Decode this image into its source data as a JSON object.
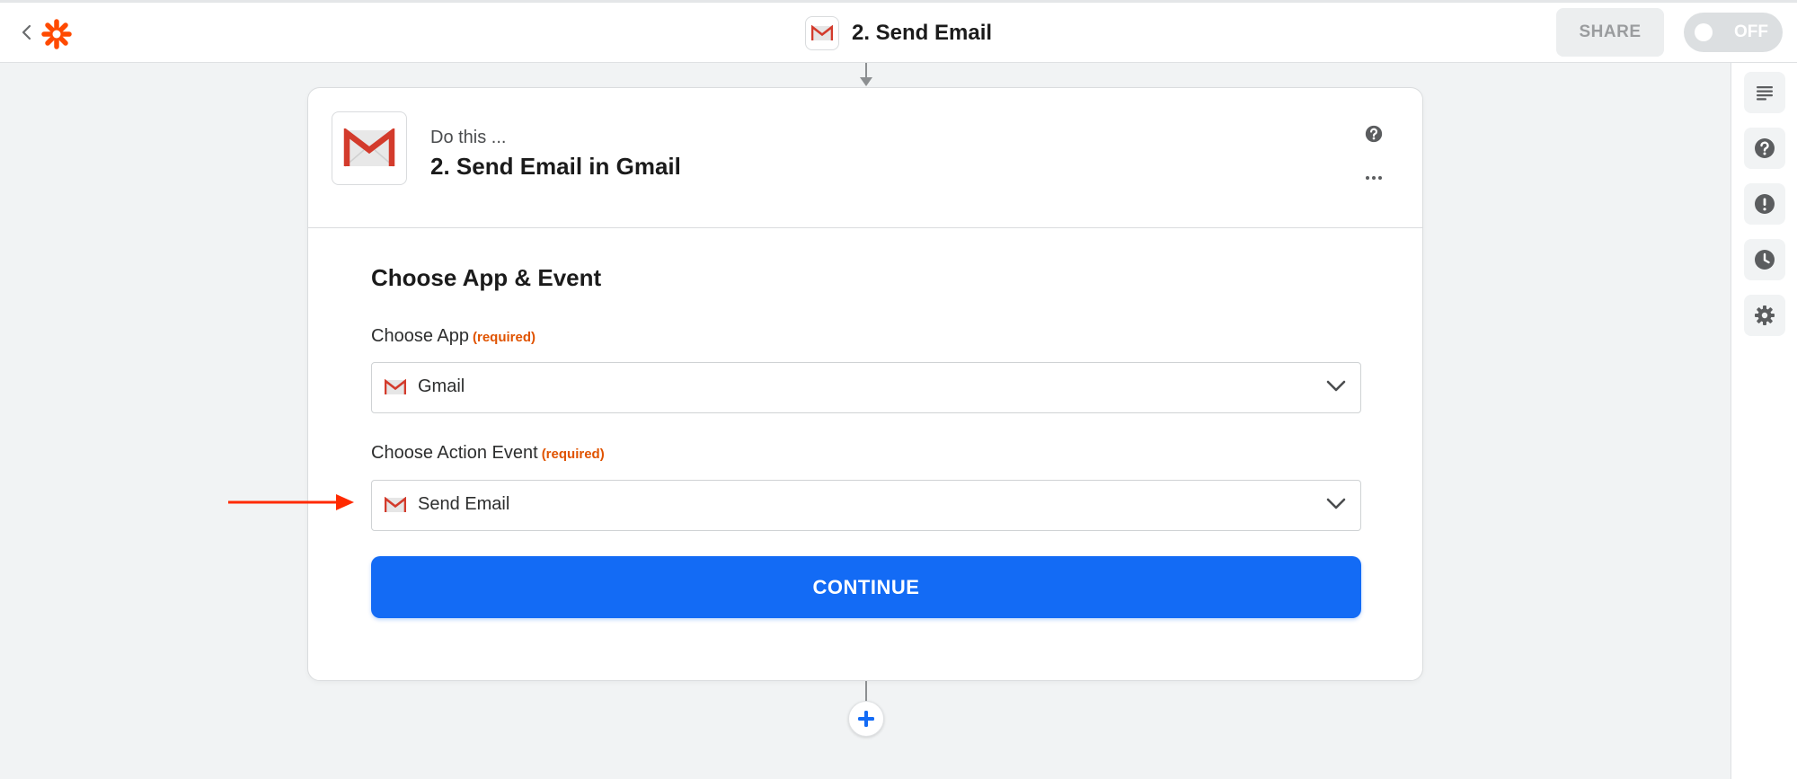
{
  "header": {
    "title": "2. Send Email",
    "share_label": "SHARE",
    "toggle_label": "OFF"
  },
  "step": {
    "subtitle": "Do this ...",
    "title": "2. Send Email in Gmail"
  },
  "form": {
    "section_title": "Choose App & Event",
    "app_label": "Choose App",
    "app_required": "(required)",
    "app_value": "Gmail",
    "event_label": "Choose Action Event",
    "event_required": "(required)",
    "event_value": "Send Email",
    "continue_label": "CONTINUE"
  },
  "icons": {
    "back": "chevron-left-icon",
    "logo": "zapier-logo-icon",
    "app": "gmail-icon",
    "help": "help-icon",
    "more": "more-icon",
    "chevron": "chevron-down-icon",
    "add": "plus-icon",
    "sidebar": [
      "outline-icon",
      "help-icon",
      "alert-icon",
      "history-icon",
      "settings-icon"
    ]
  },
  "colors": {
    "accent": "#136bf5",
    "brand": "#ff4a00",
    "required": "#e05300",
    "annotation": "#ff2a00"
  }
}
